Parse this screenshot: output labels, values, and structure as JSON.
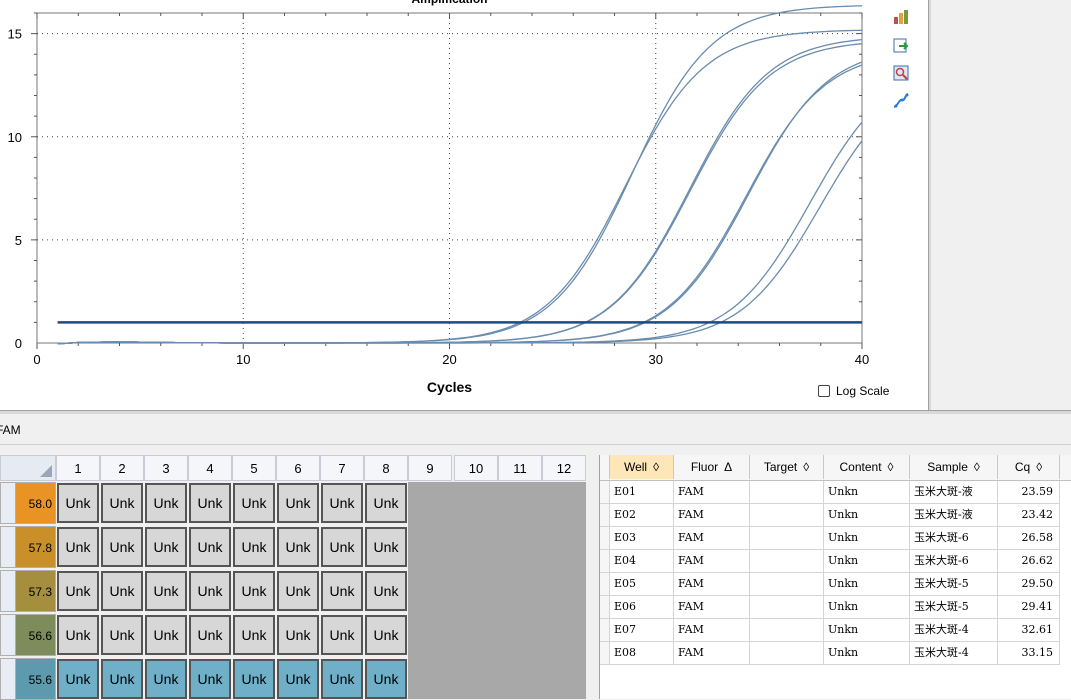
{
  "chart_data": {
    "type": "line",
    "title": "Amplification",
    "xlabel": "Cycles",
    "ylabel": "",
    "xlim": [
      0,
      40
    ],
    "ylim": [
      0,
      16
    ],
    "xticks": [
      0,
      10,
      20,
      30,
      40
    ],
    "yticks": [
      0,
      5,
      10,
      15
    ],
    "threshold": 1.0,
    "grid": true,
    "series": [
      {
        "cq": 23.59,
        "plateau": 16.4
      },
      {
        "cq": 23.42,
        "plateau": 15.2
      },
      {
        "cq": 26.58,
        "plateau": 14.9
      },
      {
        "cq": 26.62,
        "plateau": 14.7
      },
      {
        "cq": 29.5,
        "plateau": 14.4
      },
      {
        "cq": 29.41,
        "plateau": 14.2
      },
      {
        "cq": 32.61,
        "plateau": 13.6
      },
      {
        "cq": 33.15,
        "plateau": 13.2
      }
    ],
    "colors": {
      "curve": "#6a8cae",
      "threshold": "#1f4a7f"
    }
  },
  "chart_tools": [
    "chart-settings-icon",
    "export-icon",
    "zoom-icon",
    "curve-icon"
  ],
  "log_scale": {
    "label": "Log Scale",
    "checked": false
  },
  "fluor_label": "FAM",
  "plate": {
    "columns": [
      "1",
      "2",
      "3",
      "4",
      "5",
      "6",
      "7",
      "8",
      "9",
      "10",
      "11",
      "12"
    ],
    "rows": [
      {
        "temp": "58.0",
        "color": "#e89324",
        "well_color": "#d7d7d7"
      },
      {
        "temp": "57.8",
        "color": "#c9902a",
        "well_color": "#d7d7d7"
      },
      {
        "temp": "57.3",
        "color": "#a58e3e",
        "well_color": "#d7d7d7"
      },
      {
        "temp": "56.6",
        "color": "#7c8c5a",
        "well_color": "#d7d7d7"
      },
      {
        "temp": "55.6",
        "color": "#5e9aae",
        "well_color": "#6fb0c8"
      }
    ],
    "well_label": "Unk",
    "filled_columns": 8
  },
  "table": {
    "headers": [
      {
        "label": "Well",
        "sort": "◊"
      },
      {
        "label": "Fluor",
        "sort": "Δ"
      },
      {
        "label": "Target",
        "sort": "◊"
      },
      {
        "label": "Content",
        "sort": "◊"
      },
      {
        "label": "Sample",
        "sort": "◊"
      },
      {
        "label": "Cq",
        "sort": "◊"
      }
    ],
    "rows": [
      {
        "well": "E01",
        "fluor": "FAM",
        "target": "",
        "content": "Unkn",
        "sample": "玉米大斑-液",
        "cq": "23.59"
      },
      {
        "well": "E02",
        "fluor": "FAM",
        "target": "",
        "content": "Unkn",
        "sample": "玉米大斑-液",
        "cq": "23.42"
      },
      {
        "well": "E03",
        "fluor": "FAM",
        "target": "",
        "content": "Unkn",
        "sample": "玉米大斑-6",
        "cq": "26.58"
      },
      {
        "well": "E04",
        "fluor": "FAM",
        "target": "",
        "content": "Unkn",
        "sample": "玉米大斑-6",
        "cq": "26.62"
      },
      {
        "well": "E05",
        "fluor": "FAM",
        "target": "",
        "content": "Unkn",
        "sample": "玉米大斑-5",
        "cq": "29.50"
      },
      {
        "well": "E06",
        "fluor": "FAM",
        "target": "",
        "content": "Unkn",
        "sample": "玉米大斑-5",
        "cq": "29.41"
      },
      {
        "well": "E07",
        "fluor": "FAM",
        "target": "",
        "content": "Unkn",
        "sample": "玉米大斑-4",
        "cq": "32.61"
      },
      {
        "well": "E08",
        "fluor": "FAM",
        "target": "",
        "content": "Unkn",
        "sample": "玉米大斑-4",
        "cq": "33.15"
      }
    ]
  }
}
